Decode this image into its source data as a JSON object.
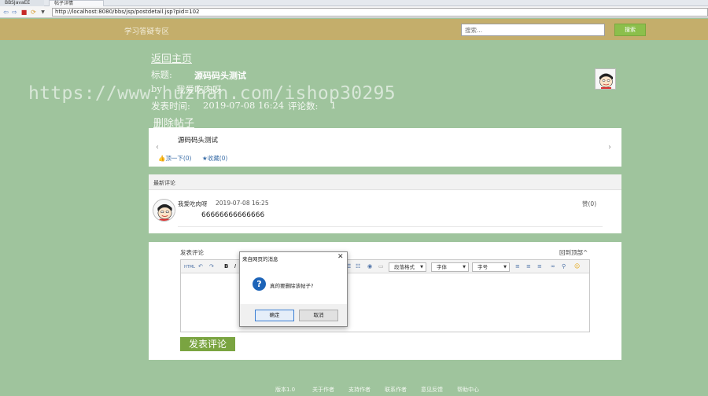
{
  "browser": {
    "tabs": [
      {
        "label": "BBSJavaEE"
      },
      {
        "label": "帖子详情"
      }
    ],
    "address": "http://localhost:8080/bbs/jsp/postdetail.jsp?pid=102"
  },
  "header": {
    "site_title": "学习答疑专区",
    "search_placeholder": "搜索...",
    "search_button": "搜索"
  },
  "post": {
    "back_link": "返回主页",
    "title_label": "标题:",
    "title": "源码码头测试",
    "by_label": "by",
    "author": "我爱吃肉呀",
    "time_label": "发表时间:",
    "time": "2019-07-08 16:24",
    "comment_count_label": "评论数:",
    "comment_count": "1",
    "delete_link": "删除帖子",
    "content": "源码码头测试",
    "like_label": "顶一下(0)",
    "favorite_label": "收藏(0)"
  },
  "watermark": "https://www.huzhan.com/ishop30295",
  "comments": {
    "header": "最新评论",
    "items": [
      {
        "user": "我爱吃肉呀",
        "time": "2019-07-08 16:25",
        "text": "66666666666666",
        "like": "赞(0)"
      }
    ]
  },
  "reply": {
    "label": "发表评论",
    "back_top": "回到顶部^",
    "submit": "发表评论",
    "toolbar": {
      "html": "HTML",
      "paragraph": "段落格式",
      "font": "字体",
      "size": "字号"
    }
  },
  "dialog": {
    "title": "来自网页的消息",
    "message": "真的要删除该帖子?",
    "ok": "确定",
    "cancel": "取消"
  },
  "footer": {
    "links": [
      "版本1.0",
      "关于作者",
      "支持作者",
      "联系作者",
      "意见反馈",
      "帮助中心"
    ]
  },
  "colors": {
    "page_bg": "#9fc49d",
    "header_bg": "#c4ae6b",
    "accent_green": "#7aa441",
    "dialog_icon": "#1d64b8"
  }
}
